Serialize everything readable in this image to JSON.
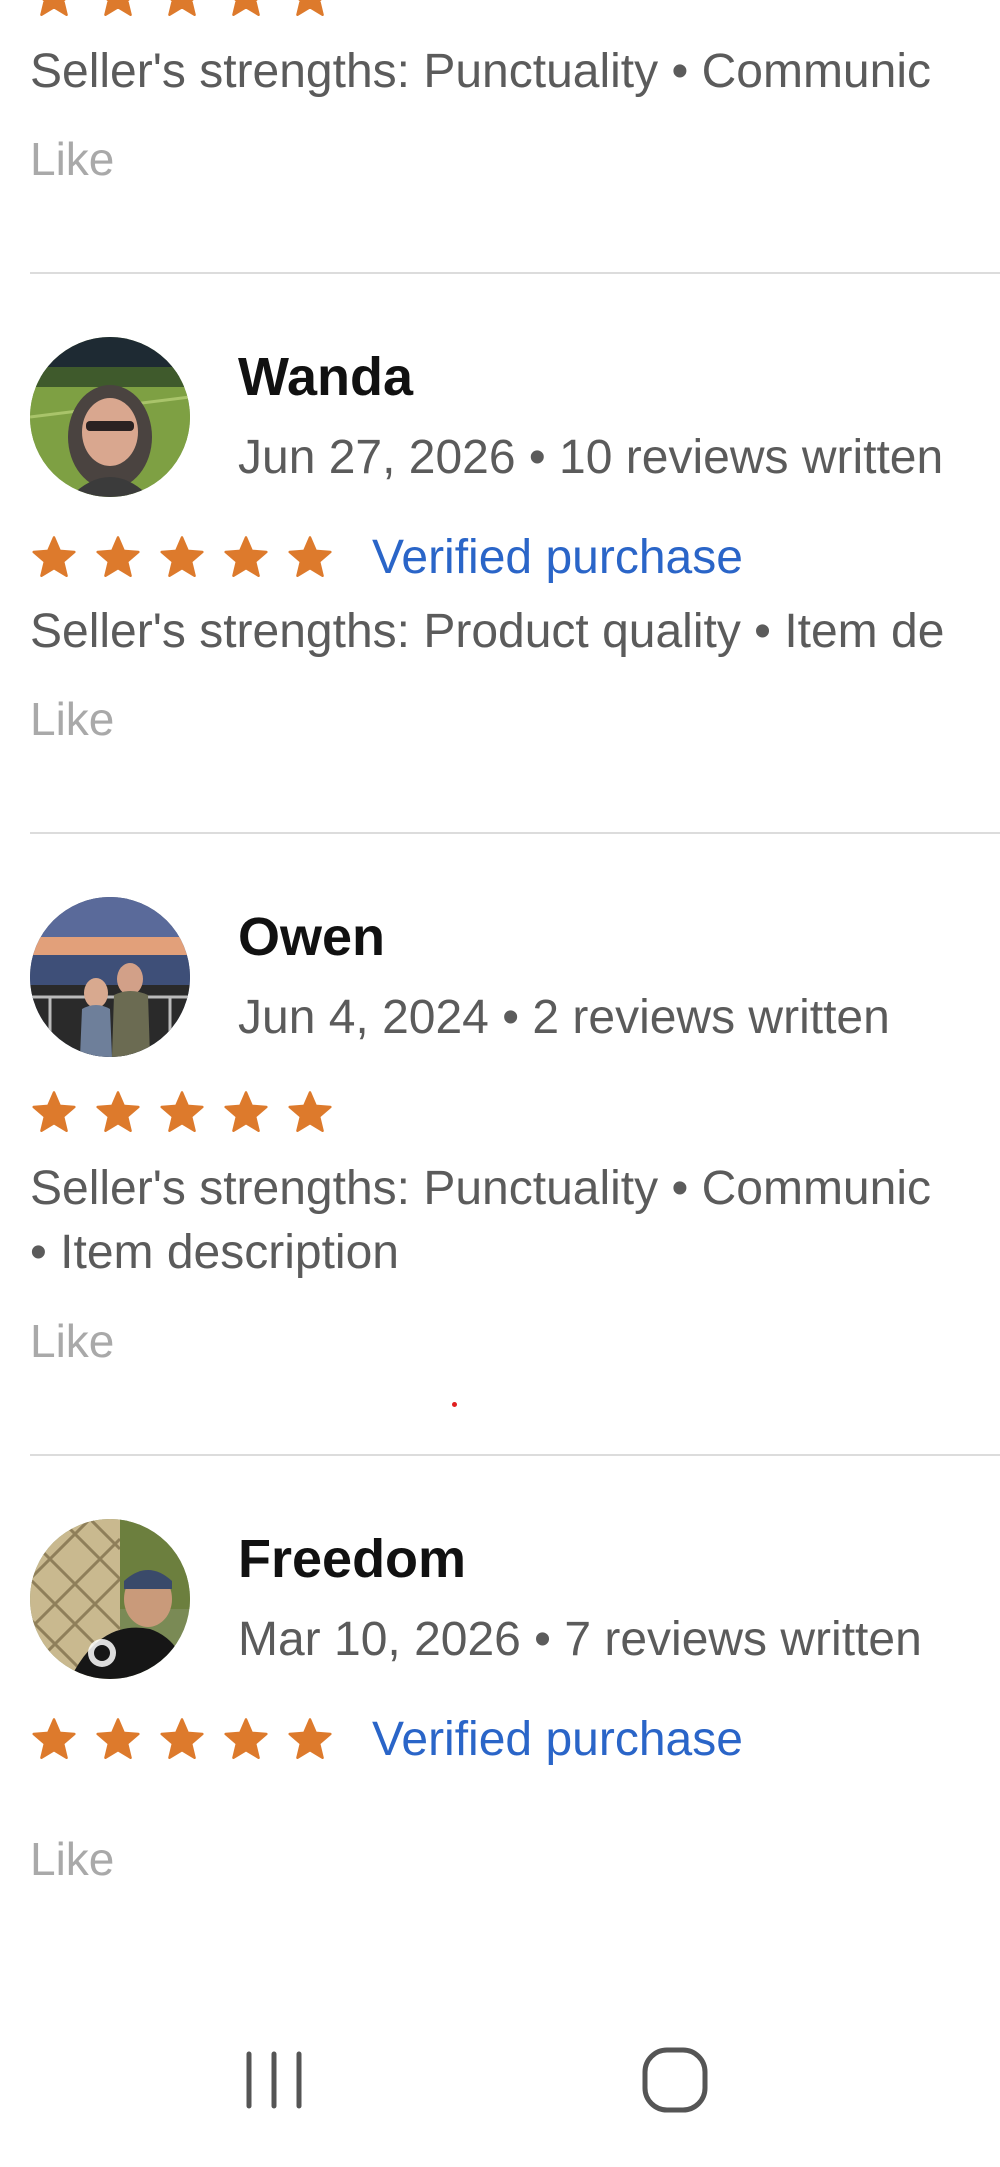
{
  "colors": {
    "star": "#dd7a2c",
    "verified": "#2a65c8",
    "like": "#a9a9a9",
    "divider": "#dcdcdc"
  },
  "reviews": [
    {
      "strengths": "Seller's strengths: Punctuality • Communic",
      "like_label": "Like",
      "rating": 5
    },
    {
      "name": "Wanda",
      "meta": "Jun 27, 2026 • 10 reviews written",
      "verified_label": "Verified purchase",
      "strengths": "Seller's strengths: Product quality • Item de",
      "like_label": "Like",
      "rating": 5
    },
    {
      "name": "Owen",
      "meta": "Jun 4, 2024 • 2 reviews written",
      "strengths_line1": "Seller's strengths: Punctuality • Communic",
      "strengths_line2": "• Item description",
      "like_label": "Like",
      "rating": 5
    },
    {
      "name": "Freedom",
      "meta": "Mar 10, 2026 • 7 reviews written",
      "verified_label": "Verified purchase",
      "like_label": "Like",
      "rating": 5
    }
  ],
  "navbar": {
    "recent_icon": "recent-apps-icon",
    "home_icon": "home-icon"
  }
}
